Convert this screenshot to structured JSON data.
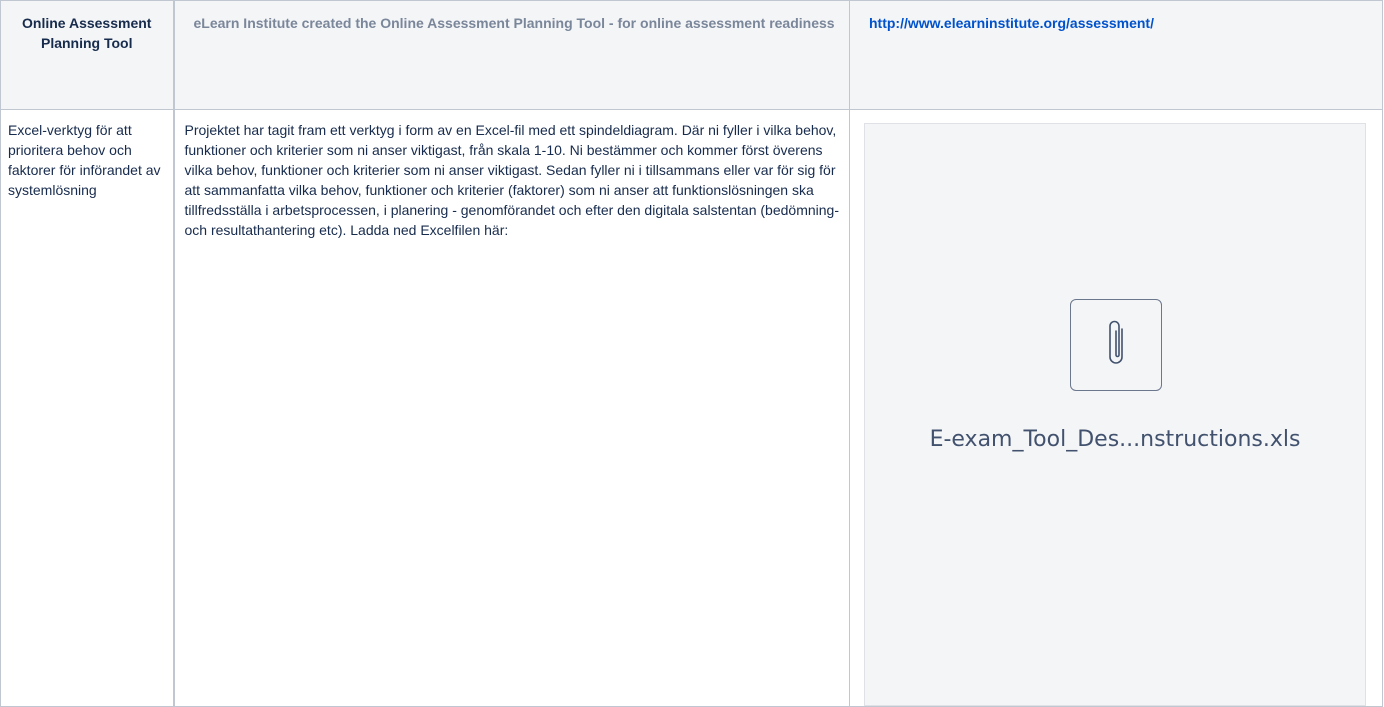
{
  "header": {
    "col1": "Online Assessment Planning Tool",
    "col2": "eLearn Institute created the Online Assessment Planning Tool - for online assessment readiness",
    "col3_link": "http://www.elearninstitute.org/assessment/"
  },
  "row": {
    "col1": "Excel-verktyg för att prioritera behov och faktorer för införandet av systemlösning",
    "col2": "Projektet har tagit fram ett verktyg i form av en Excel-fil med ett spindeldiagram. Där ni fyller i vilka behov, funktioner och kriterier som ni anser viktigast, från skala 1-10. Ni bestämmer och kommer först överens vilka behov, funktioner och kriterier som ni anser viktigast. Sedan fyller ni i tillsammans eller var för sig för att sammanfatta vilka behov, funktioner och kriterier (faktorer) som ni anser att funktionslösningen ska tillfredsställa i arbetsprocessen, i planering - genomförandet och efter den digitala salstentan (bedömning- och resultathantering etc). Ladda ned Excelfilen här:",
    "attachment": {
      "icon": "paperclip-icon",
      "filename": "E-exam_Tool_Des...nstructions.xls"
    }
  }
}
